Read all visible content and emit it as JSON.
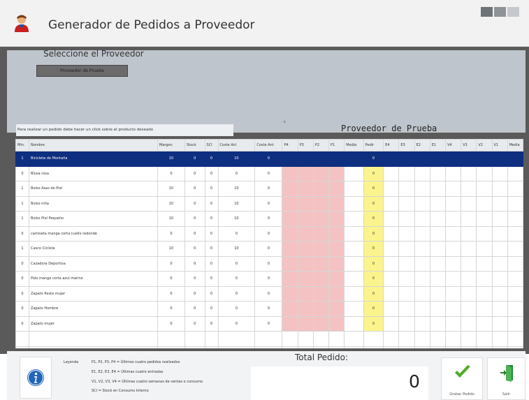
{
  "window": {
    "title": "Generador de Pedidos a Proveedor"
  },
  "supplier": {
    "select_label": "Seleccione el Proveedor",
    "button_label": "Proveedor de Prueba",
    "name": "Proveedor de Prueba",
    "hint": "Para realizar un pedido debe hacer un click sobre el producto deseado",
    "marker": "c"
  },
  "columns": [
    "Min.",
    "Nombre",
    "Margen",
    "Stock",
    "SCI",
    "Coste Act",
    "Coste Ant",
    "P4",
    "P3",
    "P2",
    "P1",
    "Media",
    "Pedir",
    "E4",
    "E3",
    "E2",
    "E1",
    "V4",
    "V3",
    "V2",
    "V1",
    "Media"
  ],
  "rows": [
    {
      "cells": [
        "1",
        "Bicicleta de Montaña",
        "10",
        "0",
        "0",
        "10",
        "0",
        "",
        "",
        "",
        "",
        "",
        "0",
        "",
        "",
        "",
        "",
        "",
        "",
        "",
        "",
        ""
      ],
      "selected": true
    },
    {
      "cells": [
        "0",
        "Blusa rosa",
        "0",
        "0",
        "0",
        "0",
        "0",
        "",
        "",
        "",
        "",
        "",
        "0",
        "",
        "",
        "",
        "",
        "",
        "",
        "",
        "",
        ""
      ]
    },
    {
      "cells": [
        "1",
        "Bolso Asas de Piel",
        "10",
        "0",
        "0",
        "10",
        "0",
        "",
        "",
        "",
        "",
        "",
        "0",
        "",
        "",
        "",
        "",
        "",
        "",
        "",
        "",
        ""
      ]
    },
    {
      "cells": [
        "1",
        "Bolso niña",
        "10",
        "0",
        "0",
        "10",
        "0",
        "",
        "",
        "",
        "",
        "",
        "0",
        "",
        "",
        "",
        "",
        "",
        "",
        "",
        "",
        ""
      ]
    },
    {
      "cells": [
        "1",
        "Bolso Piel Pequeño",
        "10",
        "0",
        "0",
        "10",
        "0",
        "",
        "",
        "",
        "",
        "",
        "0",
        "",
        "",
        "",
        "",
        "",
        "",
        "",
        "",
        ""
      ]
    },
    {
      "cells": [
        "0",
        "camiseta manga corta cuello redonde",
        "0",
        "0",
        "0",
        "0",
        "0",
        "",
        "",
        "",
        "",
        "",
        "0",
        "",
        "",
        "",
        "",
        "",
        "",
        "",
        "",
        ""
      ]
    },
    {
      "cells": [
        "1",
        "Casco Ciclista",
        "10",
        "0",
        "0",
        "10",
        "0",
        "",
        "",
        "",
        "",
        "",
        "0",
        "",
        "",
        "",
        "",
        "",
        "",
        "",
        "",
        ""
      ]
    },
    {
      "cells": [
        "0",
        "Cazadora Deportiva",
        "0",
        "0",
        "0",
        "0",
        "0",
        "",
        "",
        "",
        "",
        "",
        "0",
        "",
        "",
        "",
        "",
        "",
        "",
        "",
        "",
        ""
      ]
    },
    {
      "cells": [
        "0",
        "Polo manga corta azul marino",
        "0",
        "0",
        "0",
        "0",
        "0",
        "",
        "",
        "",
        "",
        "",
        "0",
        "",
        "",
        "",
        "",
        "",
        "",
        "",
        "",
        ""
      ]
    },
    {
      "cells": [
        "0",
        "Zapato fiesta mujer",
        "0",
        "0",
        "0",
        "0",
        "0",
        "",
        "",
        "",
        "",
        "",
        "0",
        "",
        "",
        "",
        "",
        "",
        "",
        "",
        "",
        ""
      ]
    },
    {
      "cells": [
        "0",
        "Zapato Hombre",
        "0",
        "0",
        "0",
        "0",
        "0",
        "",
        "",
        "",
        "",
        "",
        "0",
        "",
        "",
        "",
        "",
        "",
        "",
        "",
        "",
        ""
      ]
    },
    {
      "cells": [
        "0",
        "Zapato mujer",
        "0",
        "0",
        "0",
        "0",
        "0",
        "",
        "",
        "",
        "",
        "",
        "0",
        "",
        "",
        "",
        "",
        "",
        "",
        "",
        "",
        ""
      ]
    }
  ],
  "legend": {
    "title": "Leyenda",
    "lines": [
      "P1, P2, P3, P4 = Últimos cuatro pedidos realizados",
      "E1, E2, E3, E4 = Últimas cuatro entradas",
      "V1, V2, V3, V4 = Últimas cuatro semanas de ventas o consumo",
      "SCI = Stock en Consumo Interno"
    ]
  },
  "total": {
    "label": "Total Pedido:",
    "value": "0"
  },
  "actions": {
    "save_label": "Grabar Pedido",
    "exit_label": "Salir"
  },
  "colors": {
    "selection": "#0e2e80",
    "purchases": "#f4c2c2",
    "order": "#fbf48c"
  },
  "icons": {
    "app": "user-icon",
    "info": "info-icon",
    "save": "check-icon",
    "exit": "exit-door-icon"
  }
}
